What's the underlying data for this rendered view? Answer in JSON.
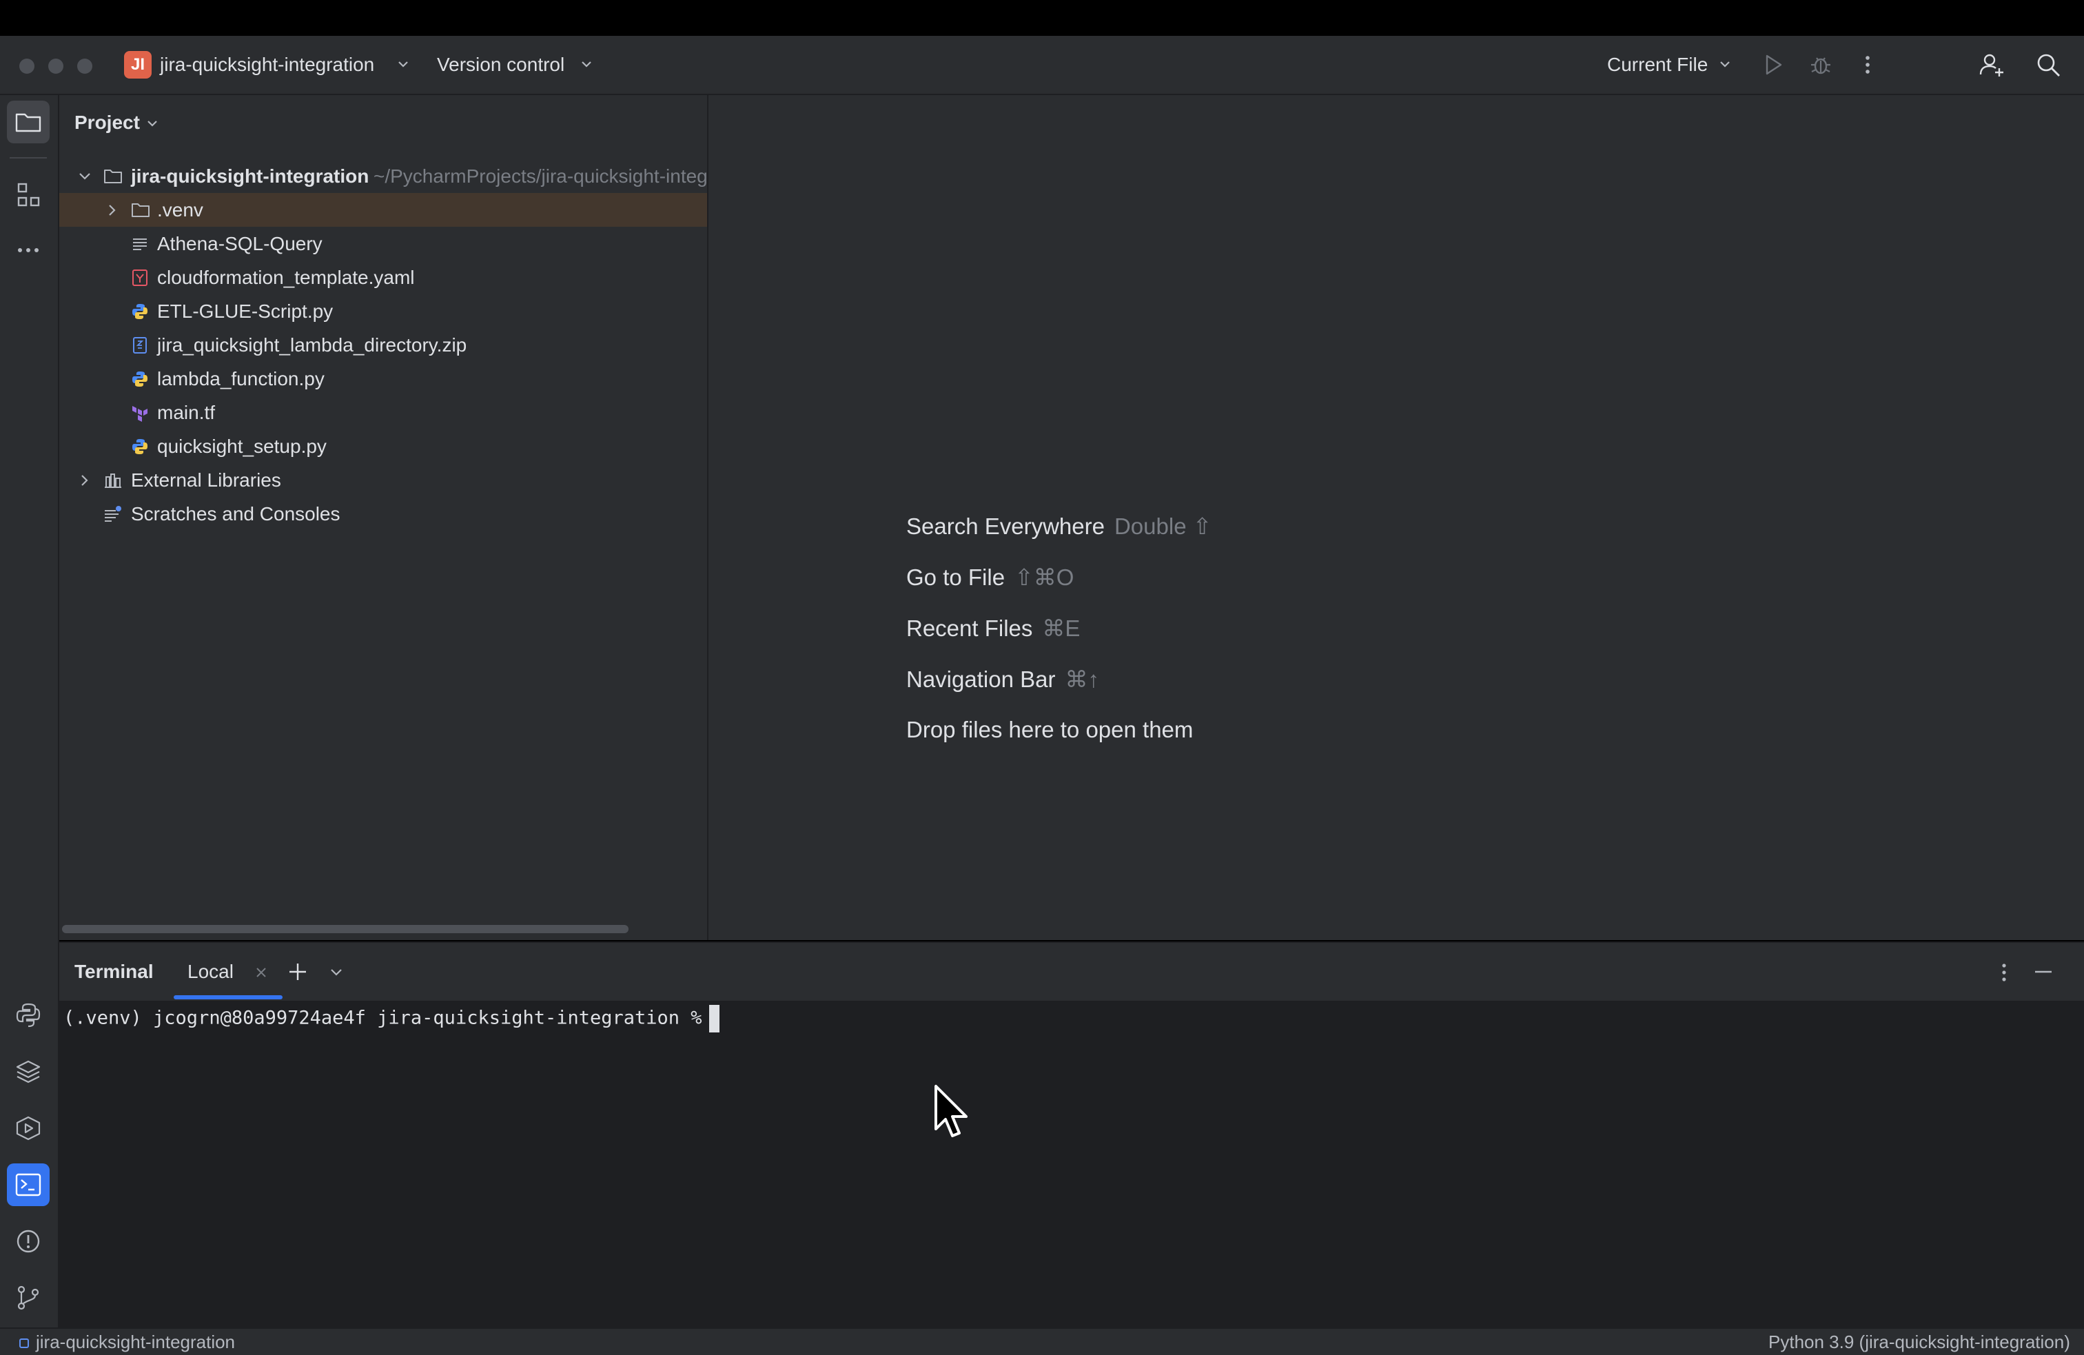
{
  "titlebar": {
    "project_badge": "JI",
    "project_name": "jira-quicksight-integration",
    "vcs_label": "Version control",
    "run_config": "Current File",
    "colors": {
      "badge": "#e0634a",
      "bg": "#2b2d30"
    }
  },
  "project_panel": {
    "title": "Project",
    "root": {
      "name": "jira-quicksight-integration",
      "path": "~/PycharmProjects/jira-quicksight-integration"
    },
    "items": [
      {
        "label": ".venv",
        "icon": "folder-icon"
      },
      {
        "label": "Athena-SQL-Query",
        "icon": "text-file-icon"
      },
      {
        "label": "cloudformation_template.yaml",
        "icon": "yaml-file-icon"
      },
      {
        "label": "ETL-GLUE-Script.py",
        "icon": "python-file-icon"
      },
      {
        "label": "jira_quicksight_lambda_directory.zip",
        "icon": "zip-file-icon"
      },
      {
        "label": "lambda_function.py",
        "icon": "python-file-icon"
      },
      {
        "label": "main.tf",
        "icon": "terraform-file-icon"
      },
      {
        "label": "quicksight_setup.py",
        "icon": "python-file-icon"
      }
    ],
    "external_libraries": "External Libraries",
    "scratches": "Scratches and Consoles"
  },
  "editor": {
    "hints": [
      {
        "label": "Search Everywhere",
        "shortcut": "Double ⇧"
      },
      {
        "label": "Go to File",
        "shortcut": "⇧⌘O"
      },
      {
        "label": "Recent Files",
        "shortcut": "⌘E"
      },
      {
        "label": "Navigation Bar",
        "shortcut": "⌘↑"
      },
      {
        "label": "Drop files here to open them",
        "shortcut": ""
      }
    ]
  },
  "terminal": {
    "title": "Terminal",
    "tab_label": "Local",
    "prompt": "(.venv) jcogrn@80a99724ae4f jira-quicksight-integration %"
  },
  "statusbar": {
    "left": "jira-quicksight-integration",
    "right": "Python 3.9 (jira-quicksight-integration)"
  }
}
